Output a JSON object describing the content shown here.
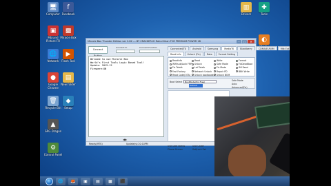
{
  "desktop_icons": [
    {
      "label": "Computer",
      "glyph": "🖥",
      "color": "#5b88c4"
    },
    {
      "label": "Mbrand Picture FR",
      "glyph": "▣",
      "color": "#c33"
    },
    {
      "label": "Network",
      "glyph": "🌐",
      "color": "#3a7bd5"
    },
    {
      "label": "Google Chrome",
      "glyph": "●",
      "color": "#db4437"
    },
    {
      "label": "Recycle Bin",
      "glyph": "🗑",
      "color": "#7aa3cf"
    },
    {
      "label": "GPG Dragon",
      "glyph": "▲",
      "color": "#555"
    },
    {
      "label": "Control Panel",
      "glyph": "⚙",
      "color": "#4e8a3b"
    },
    {
      "label": "Facebook",
      "glyph": "f",
      "color": "#3b5998"
    },
    {
      "label": "Miracle Box",
      "glyph": "▩",
      "color": "#c0392b"
    },
    {
      "label": "Flash Tool",
      "glyph": "▶",
      "color": "#d35400"
    },
    {
      "label": "New folder",
      "glyph": "▤",
      "color": "#e6b84a"
    },
    {
      "label": "Setup",
      "glyph": "◆",
      "color": "#2980b9"
    },
    {
      "label": "Drivers",
      "glyph": "▥",
      "color": "#e6b84a"
    },
    {
      "label": "Tools",
      "glyph": "✚",
      "color": "#16a085"
    },
    {
      "label": "Photos",
      "glyph": "◐",
      "color": "#e67e22"
    },
    {
      "label": "VLC",
      "glyph": "▼",
      "color": "#e67e22"
    },
    {
      "label": "Miracle Thunder",
      "glyph": "▧",
      "color": "#8e44ad"
    },
    {
      "label": "Box Loader",
      "glyph": "▦",
      "color": "#2c3e50"
    },
    {
      "label": "Mobile",
      "glyph": "▯",
      "color": "#e6b84a"
    },
    {
      "label": "Files",
      "glyph": "▤",
      "color": "#e6b84a"
    },
    {
      "label": "Mi",
      "glyph": "m",
      "color": "#d35400"
    },
    {
      "label": "Player",
      "glyph": "▷",
      "color": "#27ae60"
    },
    {
      "label": "Flash Thunder",
      "glyph": "▣",
      "color": "#c0392b"
    },
    {
      "label": "Tool",
      "glyph": "■",
      "color": "#7f8c8d"
    }
  ],
  "window": {
    "title": "Miracle Box Thunder Edition  ver 2.82  ---  BY CRACKER.IO  Rahul Khan  THE PREMIUM POWER 1B",
    "minimize": "–",
    "maximize": "□",
    "close": "✕"
  },
  "left_pane": {
    "connect_label": "Connect Button",
    "port_label": "Connect to",
    "port_value": "",
    "speed_label": "Connect Function",
    "speed_value": "",
    "log_lines": [
      "Welcome to use Miracle Box",
      "World's First Tools Logic Based Tool!",
      "Update: 2019-12",
      "Firmware:ON"
    ],
    "scroll_glyph": "◀▶"
  },
  "tabs_top": [
    "Connected/TX",
    "Android",
    "Samsung",
    "MediaTK",
    "Blackberry",
    "CDMA/EUR/IM",
    "Mtk Ext Pro"
  ],
  "tabs_second": [
    "Read info",
    "Unlock (Fix)",
    "Data",
    "Format Setting"
  ],
  "options": [
    {
      "label": "Readinfo",
      "selected": false
    },
    {
      "label": "Read",
      "selected": false
    },
    {
      "label": "Write",
      "selected": false
    },
    {
      "label": "Format",
      "selected": true
    },
    {
      "label": "Wifi/sub/Lock FRP",
      "selected": false
    },
    {
      "label": "Unlock",
      "selected": false
    },
    {
      "label": "Safe Mode",
      "selected": false
    },
    {
      "label": "FixDeadBoot",
      "selected": false
    },
    {
      "label": "Fix Totalk",
      "selected": false
    },
    {
      "label": "Lot Totalk",
      "selected": false
    },
    {
      "label": "Fix Mode",
      "selected": false
    },
    {
      "label": "IMI Read",
      "selected": false
    },
    {
      "label": "Fast Factory",
      "selected": false
    },
    {
      "label": "Network Unlock",
      "selected": false
    },
    {
      "label": "Repair PD",
      "selected": false
    },
    {
      "label": "BBK Write",
      "selected": false
    },
    {
      "label": "Read Code(OTA)",
      "selected": false
    },
    {
      "label": "Unlock bootloader",
      "selected": false
    },
    {
      "label": "Unlock BOM",
      "selected": false
    }
  ],
  "model": {
    "label": "Boot Select",
    "value": "BootMode(Pin Free)",
    "highlight": "Default",
    "radio_labels": [
      "Safe Mode",
      "Auto",
      "Advanced(Fix)"
    ]
  },
  "logo_text": "Miracle",
  "progress": {
    "label_a": "USB Dad Status",
    "label_b": "USB Calibr",
    "label_c": "Phone Screen",
    "label_d": "Set/Lock Ext"
  },
  "status_bar": {
    "left": "Ready(MTK)",
    "right": "Update(s):20:10PM"
  },
  "taskbar_items": [
    "🌐",
    "🦊",
    "▣",
    "▤",
    "▩",
    "⬛"
  ]
}
